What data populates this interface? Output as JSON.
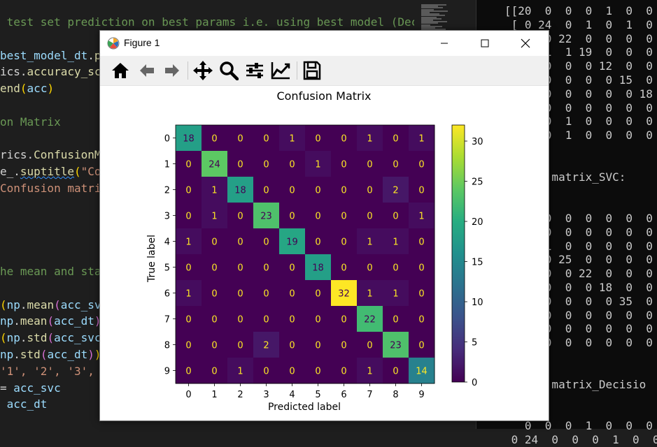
{
  "editor": {
    "lines": [
      {
        "segments": [
          {
            "t": " test set prediction on best params i.e. using best model (Dec",
            "c": "c-comment"
          }
        ]
      },
      {
        "segments": []
      },
      {
        "segments": [
          {
            "t": "best_model_dt",
            "c": "c-var"
          },
          {
            "t": ".",
            "c": ""
          },
          {
            "t": "pr",
            "c": "c-func"
          }
        ]
      },
      {
        "segments": [
          {
            "t": "ics.",
            "c": ""
          },
          {
            "t": "accuracy_sc",
            "c": "c-func"
          }
        ]
      },
      {
        "segments": [
          {
            "t": "end",
            "c": "c-func"
          },
          {
            "t": "(",
            "c": "c-paren1"
          },
          {
            "t": "acc",
            "c": "c-var"
          },
          {
            "t": ")",
            "c": "c-paren1"
          }
        ]
      },
      {
        "segments": []
      },
      {
        "segments": [
          {
            "t": "on Matrix",
            "c": "c-comment"
          }
        ]
      },
      {
        "segments": []
      },
      {
        "segments": [
          {
            "t": "rics.",
            "c": ""
          },
          {
            "t": "ConfusionMa",
            "c": "c-func"
          }
        ]
      },
      {
        "segments": [
          {
            "t": "e_.",
            "c": ""
          },
          {
            "t": "suptitle",
            "c": "c-func c-squiggle"
          },
          {
            "t": "(",
            "c": "c-paren1"
          },
          {
            "t": "\"Co",
            "c": "c-str"
          }
        ]
      },
      {
        "segments": [
          {
            "t": "Confusion matrix",
            "c": "c-str"
          }
        ]
      },
      {
        "segments": []
      },
      {
        "segments": []
      },
      {
        "segments": []
      },
      {
        "segments": []
      },
      {
        "segments": [
          {
            "t": "he mean and sta",
            "c": "c-comment"
          }
        ]
      },
      {
        "segments": []
      },
      {
        "segments": [
          {
            "t": "(",
            "c": "c-paren1"
          },
          {
            "t": "np",
            "c": "c-var"
          },
          {
            "t": ".",
            "c": ""
          },
          {
            "t": "mean",
            "c": "c-func"
          },
          {
            "t": "(",
            "c": "c-paren2"
          },
          {
            "t": "acc_svc",
            "c": "c-var"
          }
        ]
      },
      {
        "segments": [
          {
            "t": "np",
            "c": "c-var"
          },
          {
            "t": ".",
            "c": ""
          },
          {
            "t": "mean",
            "c": "c-func"
          },
          {
            "t": "(",
            "c": "c-paren2"
          },
          {
            "t": "acc_dt",
            "c": "c-var"
          },
          {
            "t": ")",
            "c": "c-paren2"
          },
          {
            "t": ")",
            "c": "c-paren1"
          }
        ]
      },
      {
        "segments": [
          {
            "t": "(",
            "c": "c-paren1"
          },
          {
            "t": "np",
            "c": "c-var"
          },
          {
            "t": ".",
            "c": ""
          },
          {
            "t": "std",
            "c": "c-func"
          },
          {
            "t": "(",
            "c": "c-paren2"
          },
          {
            "t": "acc_svc",
            "c": "c-var"
          },
          {
            "t": ")",
            "c": "c-paren2"
          }
        ]
      },
      {
        "segments": [
          {
            "t": "np",
            "c": "c-var"
          },
          {
            "t": ".",
            "c": ""
          },
          {
            "t": "std",
            "c": "c-func"
          },
          {
            "t": "(",
            "c": "c-paren2"
          },
          {
            "t": "acc_dt",
            "c": "c-var"
          },
          {
            "t": ")",
            "c": "c-paren2"
          },
          {
            "t": ")",
            "c": "c-paren1"
          }
        ]
      },
      {
        "segments": [
          {
            "t": "'1', '2', '3',",
            "c": "c-str"
          }
        ]
      },
      {
        "segments": [
          {
            "t": "= ",
            "c": ""
          },
          {
            "t": "acc_svc",
            "c": "c-var"
          }
        ]
      },
      {
        "segments": [
          {
            "t": " acc_dt",
            "c": "c-var"
          }
        ]
      }
    ]
  },
  "terminal": {
    "lines": [
      "[[20  0  0  0  1  0  0  0",
      " [ 0 24  0  1  0  1  0  0",
      "   0  0 22  0  0  0  0  0",
      "   0  1  1 19  0  0  0  0",
      "   0  0  0  0 12  0  0  0",
      "   0  0  0  0  0 15  0  0",
      "   0  0  0  0  0  0 18  0",
      "   1  0  0  0  0  0  0 21",
      "   1  0  1  0  0  0  0  0",
      "   0  0  1  0  0  0  0  0",
      "",
      "",
      "   ion matrix_SVC:",
      "",
      "",
      "   0  0  0  0  0  0  0  0",
      "   5  0  0  0  0  0  0  0",
      "   0 21  0  0  0  0  0  0",
      "   0  0 25  0  0  0  0  0",
      "   0  0  0 22  0  0  0  0",
      "   0  0  0  0 18  0  0  0",
      "   0  0  0  0  0 35  0  0",
      "   0  0  0  0  0  0  0 21",
      "   0  0  0  0  0  0  0  0",
      "   0  0  0  0  0  0  0  0",
      "",
      "",
      "   ion matrix_Decisio",
      "",
      "",
      "   0  0  0  1  0  0  0  0",
      " 0 24  0  0  0  1  0  0"
    ]
  },
  "figure": {
    "window_title": "Figure 1",
    "minimize_label": "Minimize",
    "maximize_label": "Maximize",
    "close_label": "Close",
    "toolbar": [
      {
        "name": "home-icon",
        "tooltip": "Home"
      },
      {
        "name": "back-arrow-icon",
        "tooltip": "Back"
      },
      {
        "name": "forward-arrow-icon",
        "tooltip": "Forward"
      },
      {
        "name": "pan-icon",
        "tooltip": "Pan"
      },
      {
        "name": "zoom-icon",
        "tooltip": "Zoom"
      },
      {
        "name": "subplots-config-icon",
        "tooltip": "Subplots"
      },
      {
        "name": "edit-axis-icon",
        "tooltip": "Customize"
      },
      {
        "name": "save-icon",
        "tooltip": "Save"
      }
    ]
  },
  "chart_data": {
    "type": "heatmap",
    "title": "Confusion Matrix",
    "xlabel": "Predicted label",
    "ylabel": "True label",
    "x_categories": [
      "0",
      "1",
      "2",
      "3",
      "4",
      "5",
      "6",
      "7",
      "8",
      "9"
    ],
    "y_categories": [
      "0",
      "1",
      "2",
      "3",
      "4",
      "5",
      "6",
      "7",
      "8",
      "9"
    ],
    "values": [
      [
        18,
        0,
        0,
        0,
        1,
        0,
        0,
        1,
        0,
        1
      ],
      [
        0,
        24,
        0,
        0,
        0,
        1,
        0,
        0,
        0,
        0
      ],
      [
        0,
        1,
        18,
        0,
        0,
        0,
        0,
        0,
        2,
        0
      ],
      [
        0,
        1,
        0,
        23,
        0,
        0,
        0,
        0,
        0,
        1
      ],
      [
        1,
        0,
        0,
        0,
        19,
        0,
        0,
        1,
        1,
        0
      ],
      [
        0,
        0,
        0,
        0,
        0,
        18,
        0,
        0,
        0,
        0
      ],
      [
        1,
        0,
        0,
        0,
        0,
        0,
        32,
        1,
        1,
        0
      ],
      [
        0,
        0,
        0,
        0,
        0,
        0,
        0,
        22,
        0,
        0
      ],
      [
        0,
        0,
        0,
        2,
        0,
        0,
        0,
        0,
        23,
        0
      ],
      [
        0,
        0,
        1,
        0,
        0,
        0,
        0,
        1,
        0,
        14
      ]
    ],
    "colormap": "viridis",
    "colorbar": {
      "min": 0,
      "max": 32,
      "ticks": [
        0,
        5,
        10,
        15,
        20,
        25,
        30
      ]
    },
    "text_color_light": "#fde725",
    "text_color_dark": "#440154",
    "grid": false
  }
}
